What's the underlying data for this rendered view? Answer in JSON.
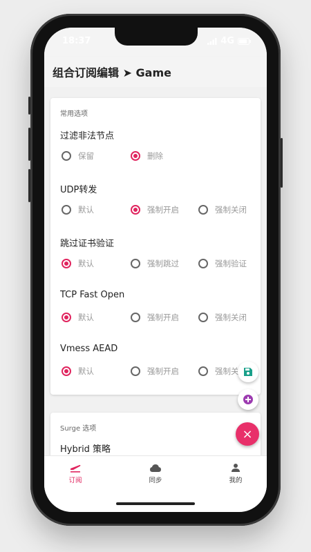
{
  "status_bar": {
    "time": "18:37",
    "network": "4G"
  },
  "app_bar": {
    "title": "组合订阅编辑 ➤ Game"
  },
  "common_card": {
    "title": "常用选项",
    "options": [
      {
        "label": "过滤非法节点",
        "choices": [
          "保留",
          "删除"
        ],
        "selected": 1
      },
      {
        "label": "UDP转发",
        "choices": [
          "默认",
          "强制开启",
          "强制关闭"
        ],
        "selected": 1
      },
      {
        "label": "跳过证书验证",
        "choices": [
          "默认",
          "强制跳过",
          "强制验证"
        ],
        "selected": 0
      },
      {
        "label": "TCP Fast Open",
        "choices": [
          "默认",
          "强制开启",
          "强制关闭"
        ],
        "selected": 0
      },
      {
        "label": "Vmess AEAD",
        "choices": [
          "默认",
          "强制开启",
          "强制关闭"
        ],
        "selected": 0
      }
    ]
  },
  "surge_card": {
    "title": "Surge 选项",
    "first_option": "Hybrid 策略"
  },
  "fabs": {
    "save": "save-icon",
    "add": "add-icon",
    "close": "close-icon",
    "close_glyph": "×"
  },
  "bottom_nav": {
    "items": [
      {
        "label": "订阅",
        "icon": "plane-icon",
        "active": true
      },
      {
        "label": "同步",
        "icon": "cloud-icon",
        "active": false
      },
      {
        "label": "我的",
        "icon": "person-icon",
        "active": false
      }
    ]
  },
  "colors": {
    "accent": "#e0245e",
    "save": "#1aa08a",
    "add": "#9c3bb0"
  }
}
